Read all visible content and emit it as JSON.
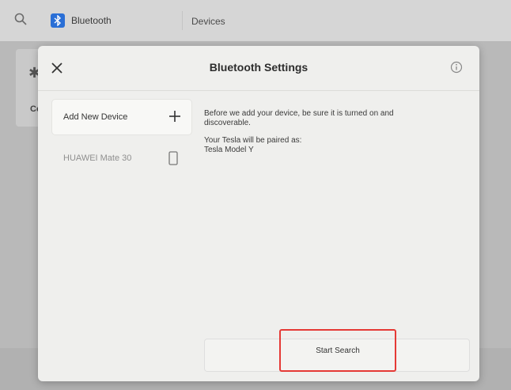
{
  "background": {
    "tab_bluetooth": "Bluetooth",
    "tab_devices": "Devices",
    "left_glyph": "✱",
    "left_text": "Co"
  },
  "modal": {
    "title": "Bluetooth Settings",
    "close_icon": "close-icon",
    "info_icon": "info-icon"
  },
  "device_list": {
    "items": [
      {
        "label": "Add New Device",
        "icon": "plus-icon"
      },
      {
        "label": "HUAWEI Mate 30",
        "icon": "phone-icon"
      }
    ]
  },
  "content": {
    "instruction_line1": "Before we add your device, be sure it is turned on and",
    "instruction_line2": "discoverable.",
    "pair_label": "Your Tesla will be paired as:",
    "vehicle_name": "Tesla Model Y"
  },
  "actions": {
    "start_search_label": "Start Search",
    "highlight_color": "#e53935"
  }
}
